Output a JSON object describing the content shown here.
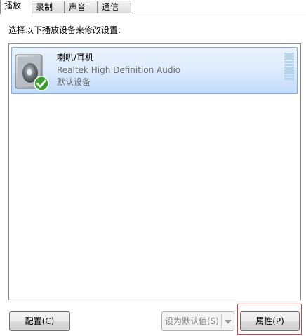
{
  "tabs": [
    {
      "label": "播放",
      "active": true
    },
    {
      "label": "录制",
      "active": false
    },
    {
      "label": "声音",
      "active": false
    },
    {
      "label": "通信",
      "active": false
    }
  ],
  "instruction": "选择以下播放设备来修改设置:",
  "devices": [
    {
      "name": "喇叭/耳机",
      "driver": "Realtek High Definition Audio",
      "status": "默认设备",
      "icon": "speaker-icon",
      "badge_icon": "check-badge-icon",
      "selected": true,
      "level": 0
    }
  ],
  "buttons": {
    "configure": "配置(C)",
    "set_default": "设为默认值(S)",
    "properties": "属性(P)"
  },
  "colors": {
    "selection_border": "#84acdd",
    "selection_bg": "#dcebfc",
    "highlight": "#e23b3b",
    "check_green": "#3ca033"
  }
}
